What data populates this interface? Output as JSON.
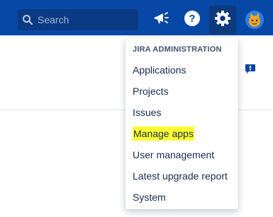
{
  "topbar": {
    "background": "#0747a6",
    "search": {
      "placeholder": "Search",
      "icon": "search-icon"
    },
    "buttons": [
      {
        "name": "notifications",
        "icon": "megaphone-icon"
      },
      {
        "name": "help",
        "icon": "question-icon"
      },
      {
        "name": "settings",
        "icon": "gear-icon"
      },
      {
        "name": "profile",
        "icon": "avatar"
      }
    ]
  },
  "feedback": {
    "icon": "feedback-icon"
  },
  "admin_menu": {
    "heading": "JIRA ADMINISTRATION",
    "items": [
      {
        "label": "Applications"
      },
      {
        "label": "Projects"
      },
      {
        "label": "Issues"
      },
      {
        "label": "Manage apps",
        "highlight": "#ffff33"
      },
      {
        "label": "User management"
      },
      {
        "label": "Latest upgrade report"
      },
      {
        "label": "System"
      }
    ]
  }
}
